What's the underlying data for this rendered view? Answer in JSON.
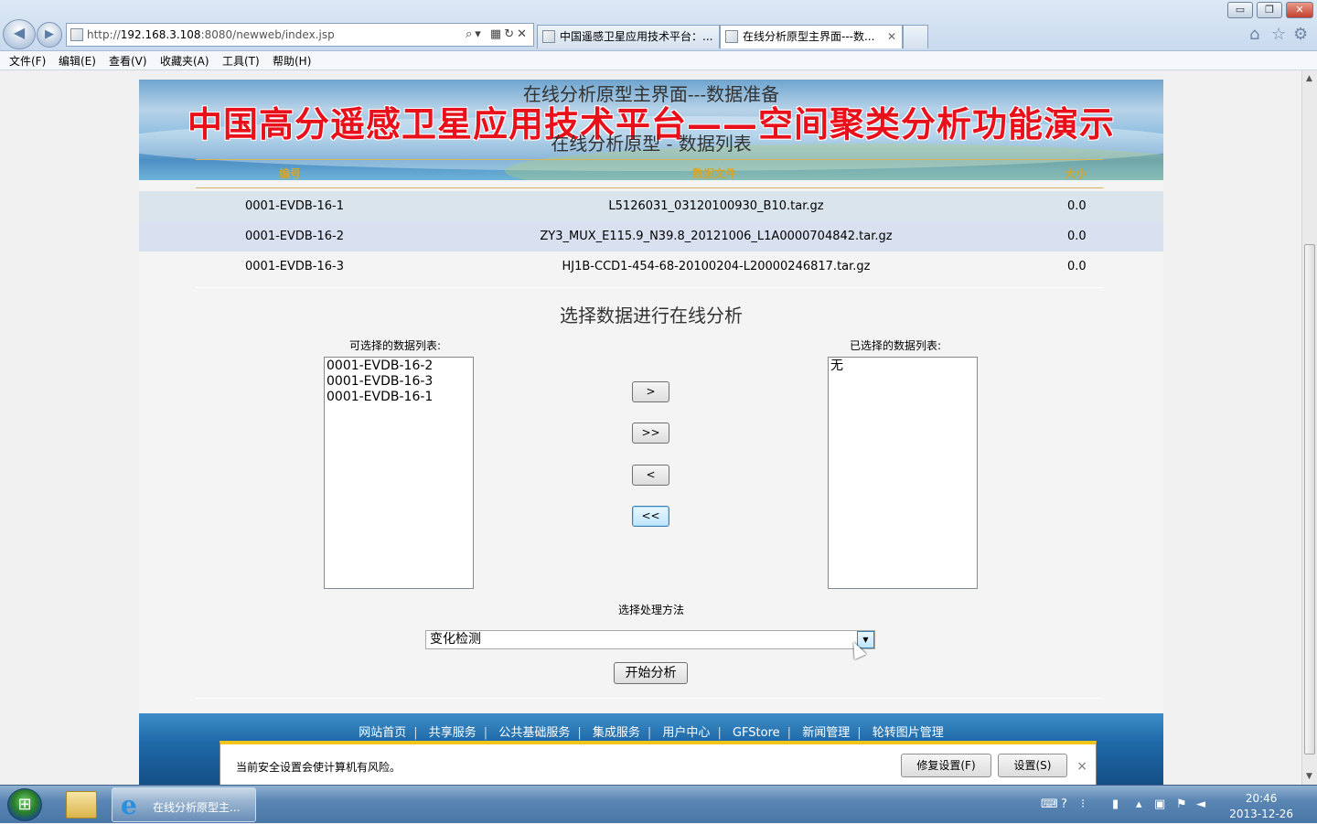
{
  "browser": {
    "url_prefix": "http://",
    "url_host": "192.168.3.108",
    "url_path": ":8080/newweb/index.jsp",
    "tabs": [
      {
        "label": "中国遥感卫星应用技术平台：..."
      },
      {
        "label": "在线分析原型主界面---数..."
      }
    ],
    "window_controls": {
      "minimize": "▭",
      "restore": "❐",
      "close": "✕"
    },
    "toolbar_icons": [
      "home-icon",
      "star-icon",
      "gear-icon"
    ]
  },
  "menubar": [
    "文件(F)",
    "编辑(E)",
    "查看(V)",
    "收藏夹(A)",
    "工具(T)",
    "帮助(H)"
  ],
  "page": {
    "header_title": "在线分析原型主界面---数据准备",
    "banner_title": "中国高分遥感卫星应用技术平台——空间聚类分析功能演示",
    "list_title": "在线分析原型 - 数据列表",
    "table": {
      "columns": [
        "编号",
        "数据文件",
        "大小"
      ],
      "rows": [
        [
          "0001-EVDB-16-1",
          "L5126031_03120100930_B10.tar.gz",
          "0.0"
        ],
        [
          "0001-EVDB-16-2",
          "ZY3_MUX_E115.9_N39.8_20121006_L1A0000704842.tar.gz",
          "0.0"
        ],
        [
          "0001-EVDB-16-3",
          "HJ1B-CCD1-454-68-20100204-L20000246817.tar.gz",
          "0.0"
        ]
      ]
    },
    "select_title": "选择数据进行在线分析",
    "available_label": "可选择的数据列表:",
    "available_items": [
      "0001-EVDB-16-2",
      "0001-EVDB-16-3",
      "0001-EVDB-16-1"
    ],
    "selected_label": "已选择的数据列表:",
    "selected_items": [
      "无"
    ],
    "buttons": {
      "add_one": ">",
      "add_all": ">>",
      "remove_one": "<",
      "remove_all": "<<"
    },
    "method_label": "选择处理方法",
    "method_value": "变化检测",
    "start_button": "开始分析",
    "footer_links": [
      "网站首页",
      "共享服务",
      "公共基础服务",
      "集成服务",
      "用户中心",
      "GFStore",
      "新闻管理",
      "轮转图片管理"
    ],
    "footer_separator": "|"
  },
  "infobar": {
    "message": "当前安全设置会使计算机有风险。",
    "fix_button": "修复设置(F)",
    "settings_button": "设置(S)",
    "close": "×"
  },
  "taskbar": {
    "ie_label": "在线分析原型主...",
    "time": "20:46",
    "date": "2013-12-26"
  }
}
